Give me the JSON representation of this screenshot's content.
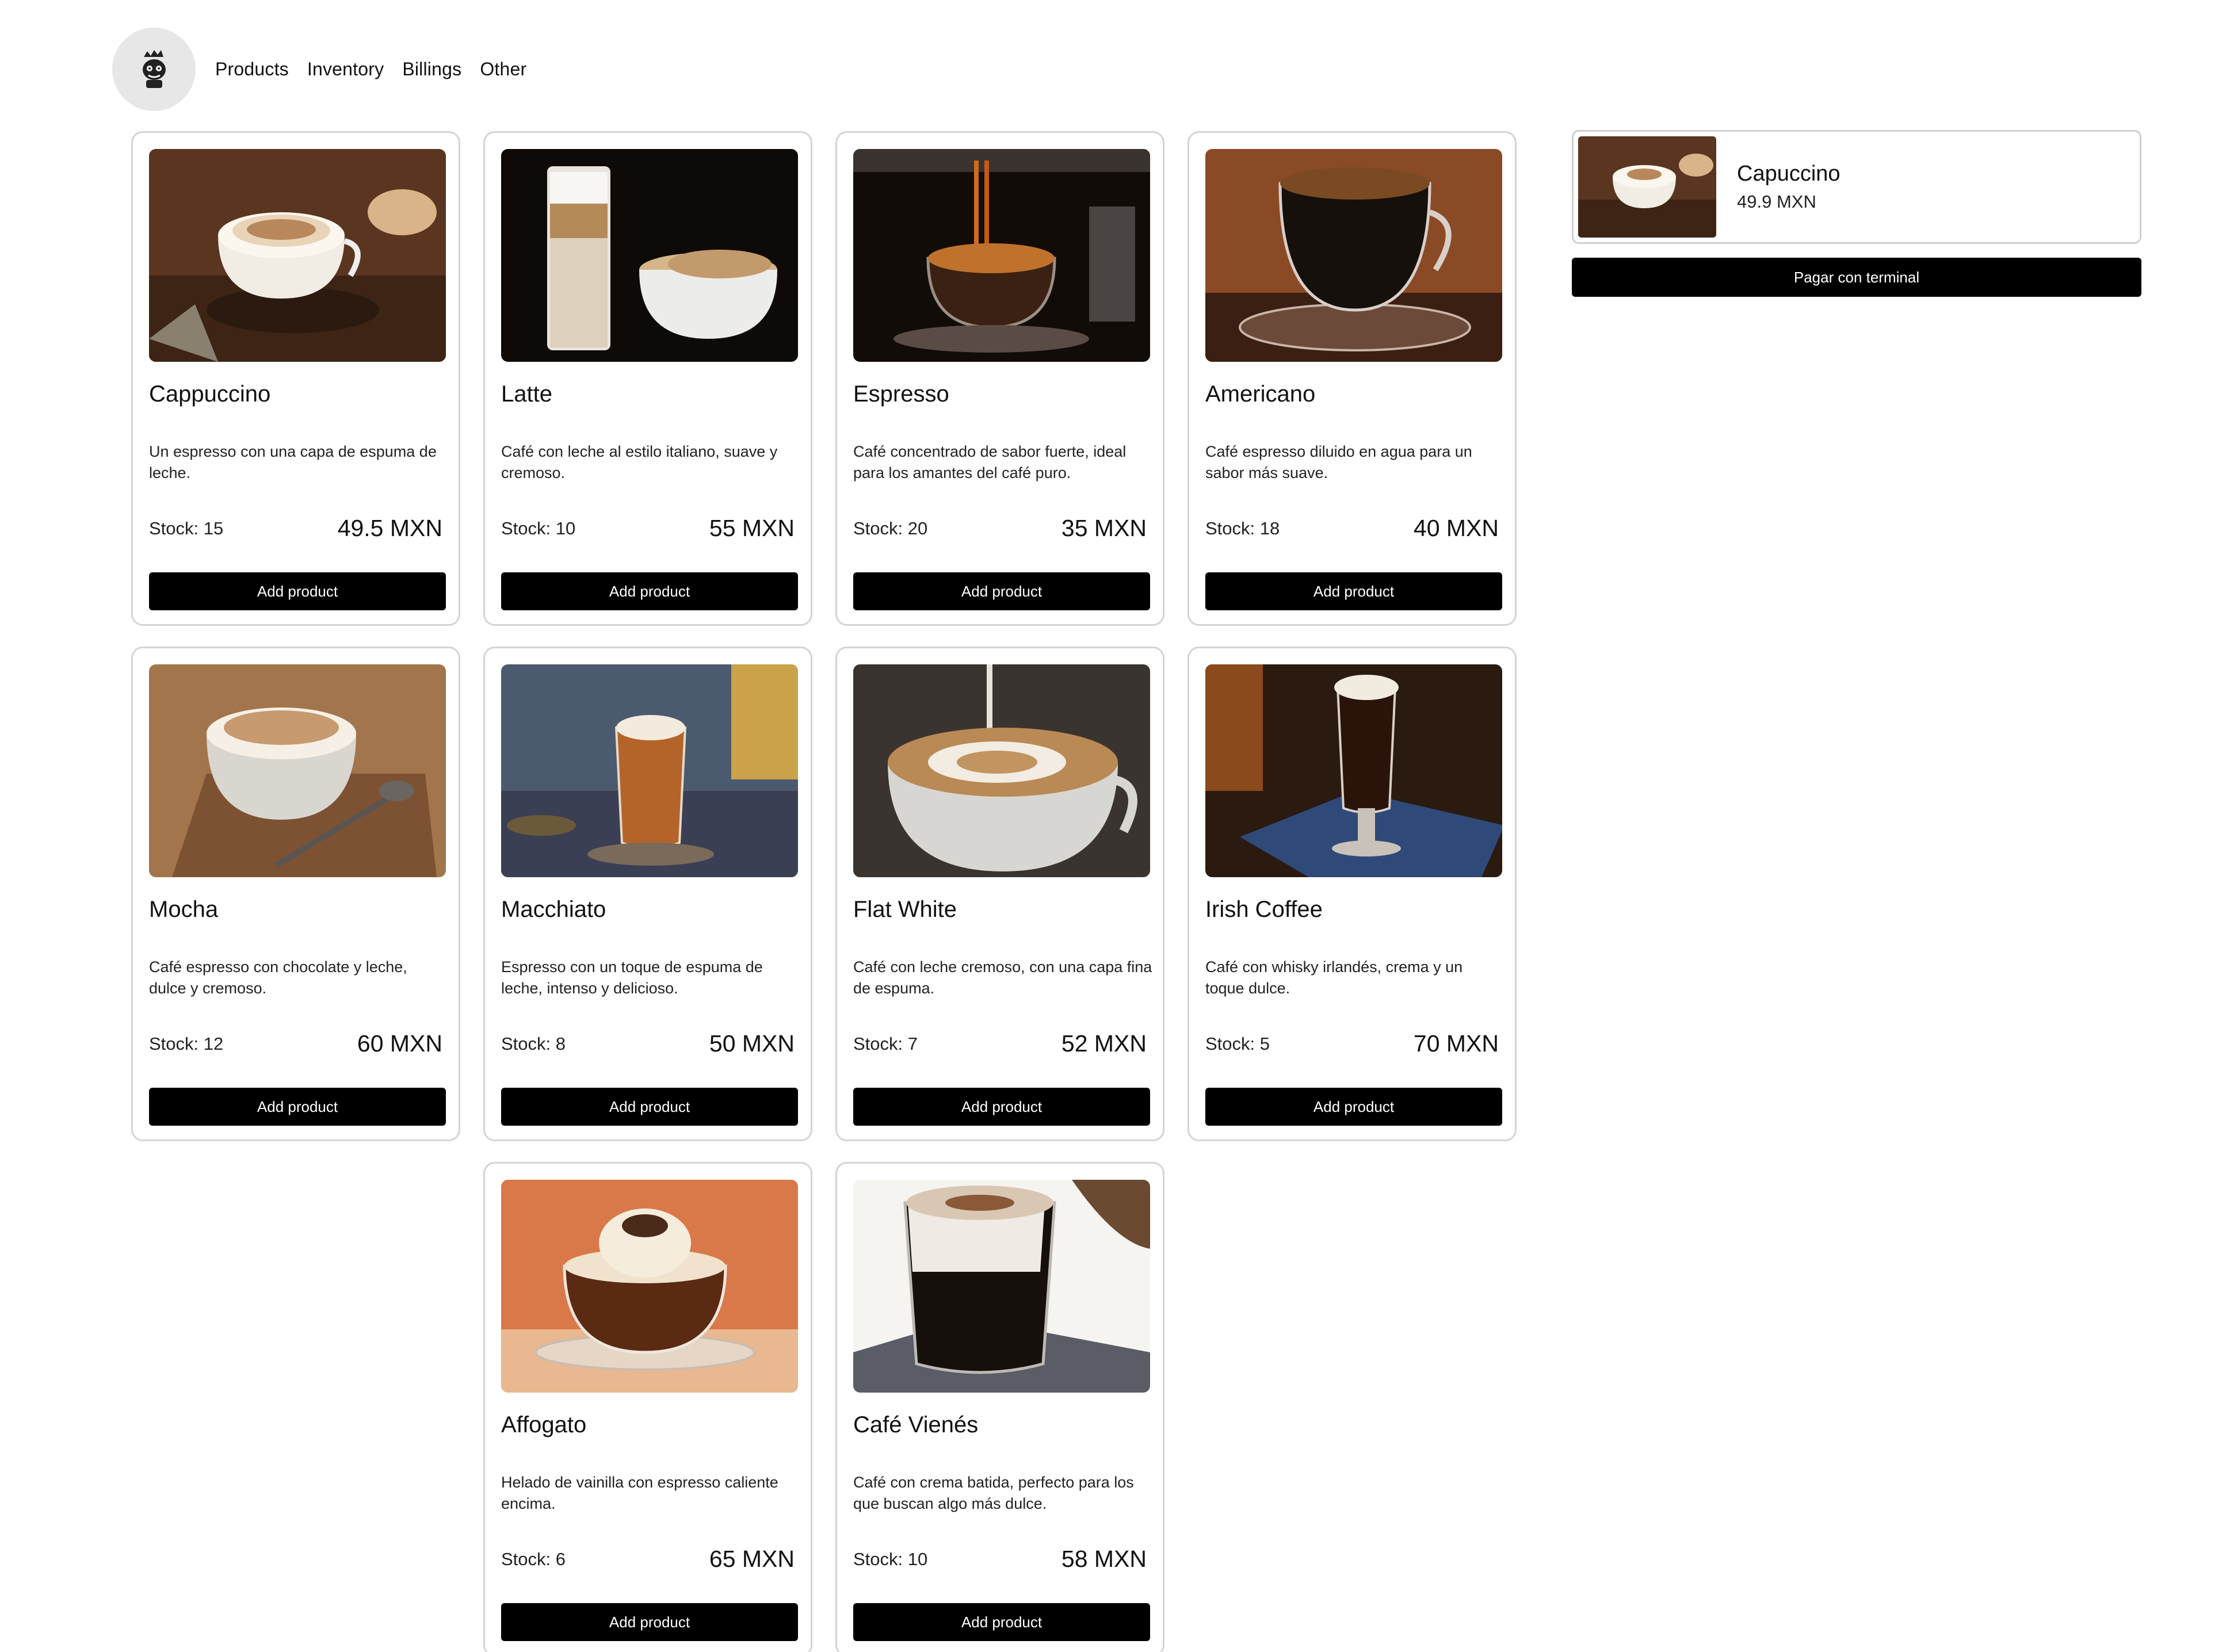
{
  "nav": {
    "items": [
      "Products",
      "Inventory",
      "Billings",
      "Other"
    ]
  },
  "products": [
    {
      "name": "Cappuccino",
      "description": "Un espresso con una capa de espuma de leche.",
      "stock": "Stock: 15",
      "price": "49.5 MXN",
      "button": "Add product"
    },
    {
      "name": "Latte",
      "description": "Café con leche al estilo italiano, suave y cremoso.",
      "stock": "Stock: 10",
      "price": "55 MXN",
      "button": "Add product"
    },
    {
      "name": "Espresso",
      "description": "Café concentrado de sabor fuerte, ideal para los amantes del café puro.",
      "stock": "Stock: 20",
      "price": "35 MXN",
      "button": "Add product"
    },
    {
      "name": "Americano",
      "description": "Café espresso diluido en agua para un sabor más suave.",
      "stock": "Stock: 18",
      "price": "40 MXN",
      "button": "Add product"
    },
    {
      "name": "Mocha",
      "description": "Café espresso con chocolate y leche, dulce y cremoso.",
      "stock": "Stock: 12",
      "price": "60 MXN",
      "button": "Add product"
    },
    {
      "name": "Macchiato",
      "description": "Espresso con un toque de espuma de leche, intenso y delicioso.",
      "stock": "Stock: 8",
      "price": "50 MXN",
      "button": "Add product"
    },
    {
      "name": "Flat White",
      "description": "Café con leche cremoso, con una capa fina de espuma.",
      "stock": "Stock: 7",
      "price": "52 MXN",
      "button": "Add product"
    },
    {
      "name": "Irish Coffee",
      "description": "Café con whisky irlandés, crema y un toque dulce.",
      "stock": "Stock: 5",
      "price": "70 MXN",
      "button": "Add product"
    },
    {
      "name": "Affogato",
      "description": "Helado de vainilla con espresso caliente encima.",
      "stock": "Stock: 6",
      "price": "65 MXN",
      "button": "Add product"
    },
    {
      "name": "Café Vienés",
      "description": "Café con crema batida, perfecto para los que buscan algo más dulce.",
      "stock": "Stock: 10",
      "price": "58 MXN",
      "button": "Add product"
    }
  ],
  "cart": {
    "items": [
      {
        "name": "Capuccino",
        "price": "49.9 MXN"
      }
    ],
    "pay_label": "Pagar con terminal"
  },
  "colors": {
    "button_bg": "#000000",
    "card_border": "#d4d4d4",
    "logo_bg": "#e7e7e7"
  }
}
